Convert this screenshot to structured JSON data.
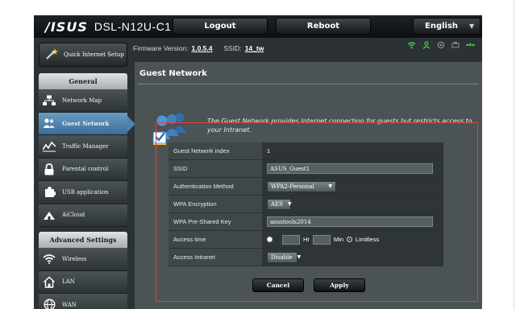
{
  "header": {
    "brand": "/ISUS",
    "model": "DSL-N12U-C1",
    "logout_label": "Logout",
    "reboot_label": "Reboot",
    "language_label": "English"
  },
  "firmware": {
    "label": "Firmware Version:",
    "version": "1.0.5.4",
    "ssid_label": "SSID:",
    "ssid": "14_tw"
  },
  "quick_setup": {
    "label": "Quick Internet Setup"
  },
  "sidebar": {
    "general_heading": "General",
    "items": [
      {
        "label": "Network Map",
        "icon": "network-map-icon"
      },
      {
        "label": "Guest Network",
        "icon": "guest-network-icon",
        "active": true
      },
      {
        "label": "Traffic Manager",
        "icon": "traffic-manager-icon"
      },
      {
        "label": "Parental control",
        "icon": "lock-icon"
      },
      {
        "label": "USB application",
        "icon": "puzzle-icon"
      },
      {
        "label": "AiCloud",
        "icon": "cloud-icon"
      }
    ],
    "advanced_heading": "Advanced Settings",
    "advanced_items": [
      {
        "label": "Wireless",
        "icon": "wifi-icon"
      },
      {
        "label": "LAN",
        "icon": "home-icon"
      },
      {
        "label": "WAN",
        "icon": "globe-icon"
      }
    ]
  },
  "main": {
    "title": "Guest Network",
    "description": "The Guest Network provides Internet connection for guests but restricts access to your Intranet."
  },
  "settings": {
    "index_label": "Guest Network index",
    "index_value": "1",
    "ssid_label": "SSID",
    "ssid_value": "ASUS_Guest1",
    "auth_label": "Authentication Method",
    "auth_value": "WPA2-Personal",
    "enc_label": "WPA Encryption",
    "enc_value": "AES",
    "psk_label": "WPA Pre-Shared Key",
    "psk_value": "asustools2014",
    "access_time_label": "Access time",
    "hr_label": "Hr",
    "min_label": "Min",
    "limitless_label": "Limitless",
    "intranet_label": "Access Intranet",
    "intranet_value": "Disable"
  },
  "actions": {
    "cancel_label": "Cancel",
    "apply_label": "Apply"
  },
  "colors": {
    "accent": "#4d82ac",
    "highlight": "#e0453a",
    "status_green": "#3ddc2f"
  }
}
